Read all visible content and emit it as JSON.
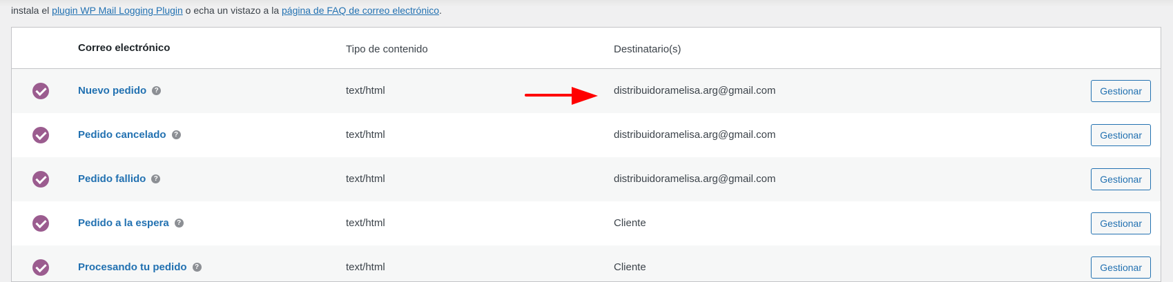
{
  "notice": {
    "prefix": "instala el ",
    "link1": "plugin WP Mail Logging Plugin",
    "middle": " o echa un vistazo a la ",
    "link2": "página de FAQ de correo electrónico",
    "suffix": "."
  },
  "table": {
    "headers": {
      "email": "Correo electrónico",
      "content_type": "Tipo de contenido",
      "recipients": "Destinatario(s)"
    },
    "rows": [
      {
        "email": "Nuevo pedido",
        "content_type": "text/html",
        "recipients": "distribuidoramelisa.arg@gmail.com",
        "action": "Gestionar"
      },
      {
        "email": "Pedido cancelado",
        "content_type": "text/html",
        "recipients": "distribuidoramelisa.arg@gmail.com",
        "action": "Gestionar"
      },
      {
        "email": "Pedido fallido",
        "content_type": "text/html",
        "recipients": "distribuidoramelisa.arg@gmail.com",
        "action": "Gestionar"
      },
      {
        "email": "Pedido a la espera",
        "content_type": "text/html",
        "recipients": "Cliente",
        "action": "Gestionar"
      },
      {
        "email": "Procesando tu pedido",
        "content_type": "text/html",
        "recipients": "Cliente",
        "action": "Gestionar"
      }
    ]
  },
  "icons": {
    "status": "check-circle-icon",
    "help": "help-icon",
    "annotation": "red-arrow"
  },
  "colors": {
    "link": "#2271b1",
    "status": "#9b5c8f",
    "arrow": "#ff0000"
  }
}
